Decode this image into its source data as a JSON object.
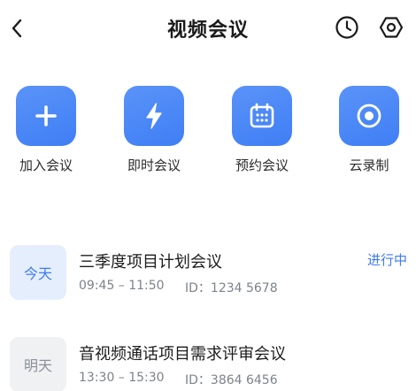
{
  "header": {
    "title": "视频会议",
    "back_icon": "chevron-left-icon",
    "history_icon": "clock-icon",
    "settings_icon": "hexagon-gear-icon"
  },
  "actions": [
    {
      "label": "加入会议",
      "icon": "plus-icon"
    },
    {
      "label": "即时会议",
      "icon": "lightning-icon"
    },
    {
      "label": "预约会议",
      "icon": "calendar-icon"
    },
    {
      "label": "云录制",
      "icon": "record-icon"
    }
  ],
  "meetings": [
    {
      "day": "今天",
      "title": "三季度项目计划会议",
      "time": "09:45 – 11:50",
      "id_text": "ID：1234 5678",
      "status": "进行中"
    },
    {
      "day": "明天",
      "title": "音视频通话项目需求评审会议",
      "time": "13:30 – 15:30",
      "id_text": "ID：3864 6456",
      "status": ""
    }
  ],
  "colors": {
    "accent": "#3e7af3",
    "tile_gradient_top": "#5a93f8",
    "today_badge_bg": "#e4eefd",
    "tomorrow_badge_bg": "#f0f1f3"
  }
}
